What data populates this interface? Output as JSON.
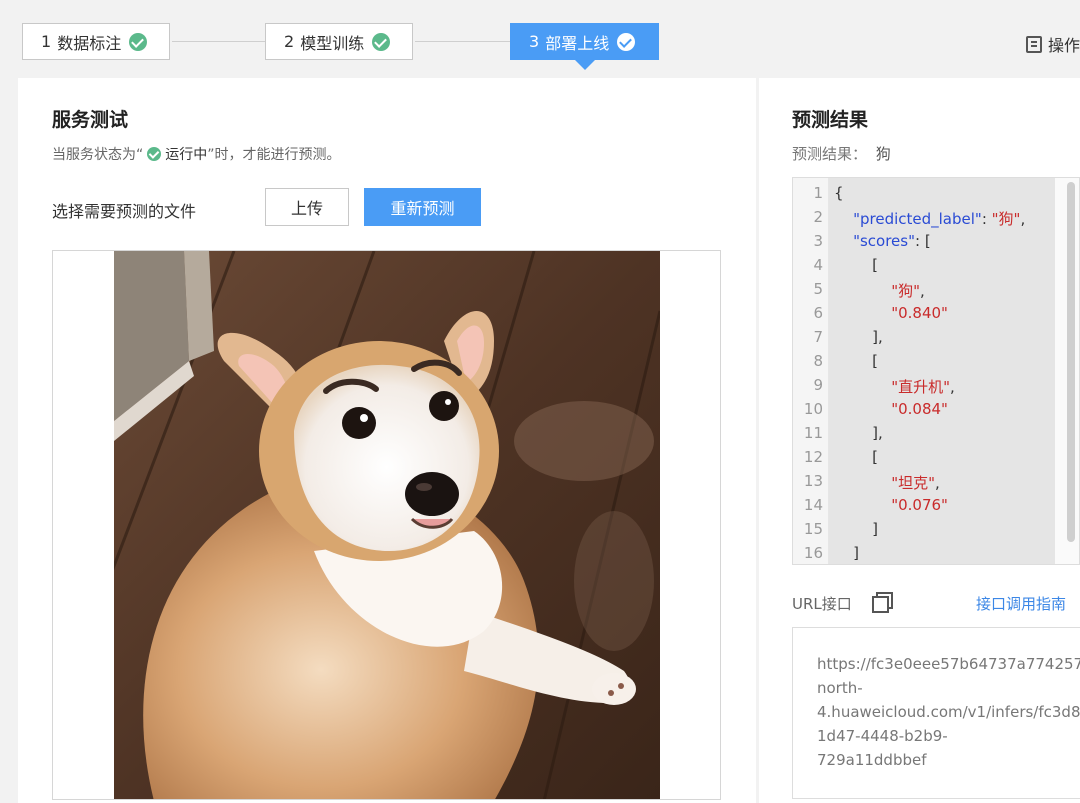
{
  "steps": [
    {
      "num": "1",
      "label": "数据标注"
    },
    {
      "num": "2",
      "label": "模型训练"
    },
    {
      "num": "3",
      "label": "部署上线"
    }
  ],
  "ops_label": "操作",
  "service_test": {
    "title": "服务测试",
    "hint_prefix": "当服务状态为“",
    "hint_status": "运行中",
    "hint_suffix": "”时，才能进行预测。",
    "file_label": "选择需要预测的文件",
    "upload_label": "上传",
    "repredict_label": "重新预测"
  },
  "prediction": {
    "title": "预测结果",
    "result_label": "预测结果：",
    "result_value": "狗",
    "code_lines": [
      "{",
      "    \"predicted_label\": \"狗\",",
      "    \"scores\": [",
      "        [",
      "            \"狗\",",
      "            \"0.840\"",
      "        ],",
      "        [",
      "            \"直升机\",",
      "            \"0.084\"",
      "        ],",
      "        [",
      "            \"坦克\",",
      "            \"0.076\"",
      "        ]",
      "    ]"
    ],
    "line_numbers": [
      "1",
      "2",
      "3",
      "4",
      "5",
      "6",
      "7",
      "8",
      "9",
      "10",
      "11",
      "12",
      "13",
      "14",
      "15",
      "16"
    ]
  },
  "api": {
    "url_label": "URL接口",
    "guide_label": "接口调用指南",
    "url_lines": [
      "https://fc3e0eee57b64737a774257",
      "north-",
      "4.huaweicloud.com/v1/infers/fc3d8",
      "1d47-4448-b2b9-",
      "729a11ddbbef"
    ]
  }
}
